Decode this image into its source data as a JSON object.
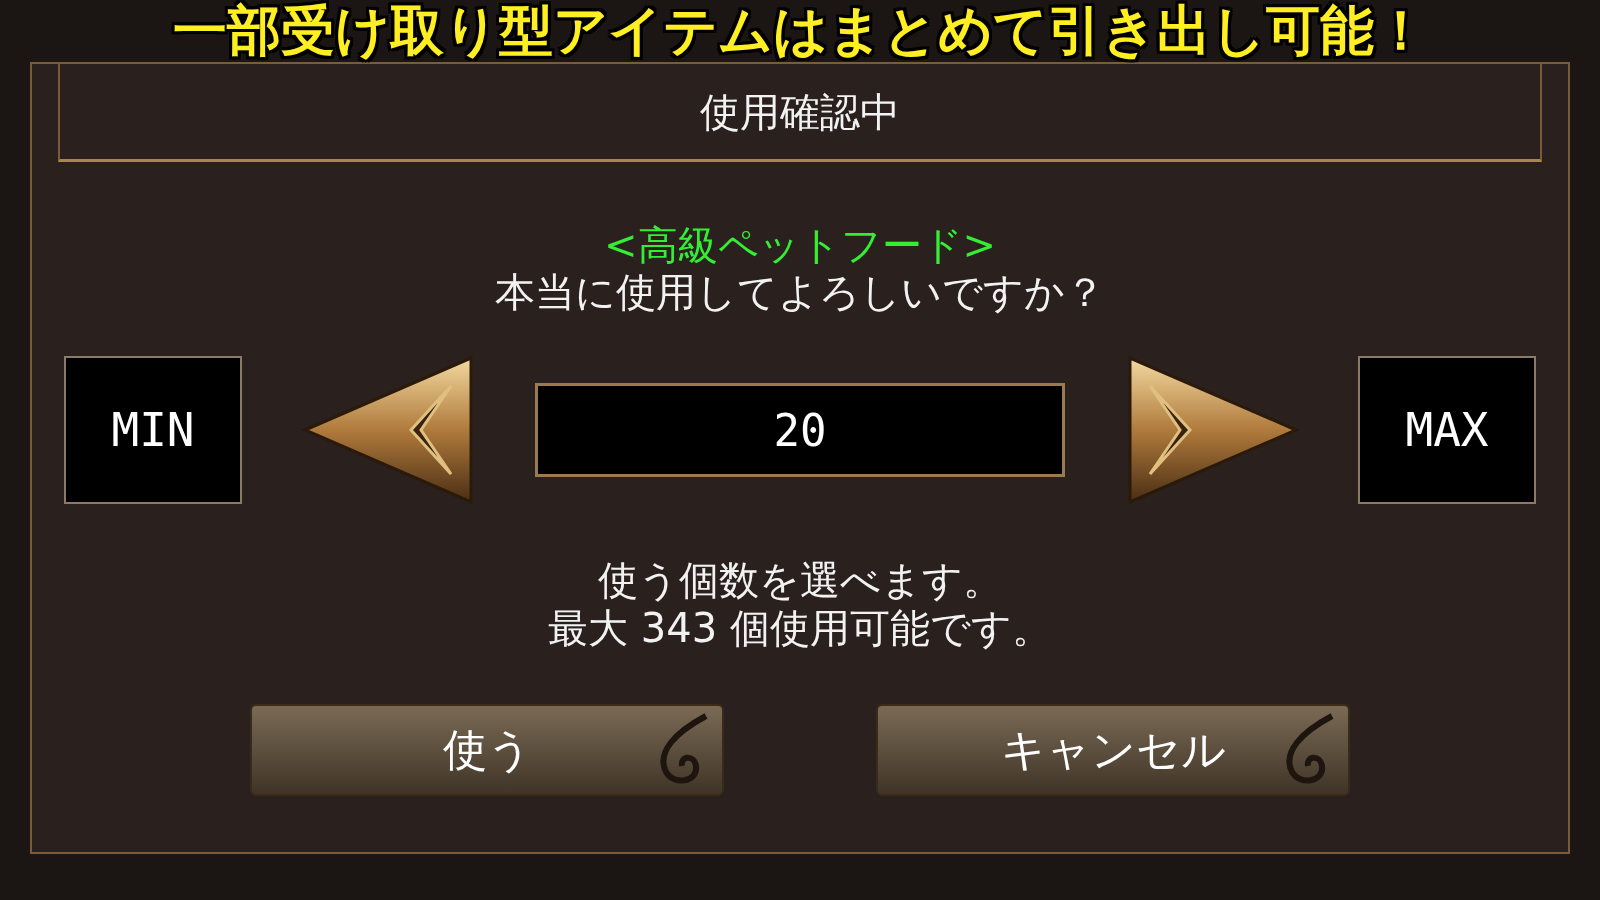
{
  "caption": "一部受け取り型アイテムはまとめて引き出し可能！",
  "dialog": {
    "title": "使用確認中",
    "item_name": "<高級ペットフード>",
    "question": "本当に使用してよろしいですか？",
    "min_button": "MIN",
    "max_button": "MAX",
    "quantity": "20",
    "info_lines": [
      "使う個数を選べます。",
      "最大 343 個使用可能です。"
    ],
    "buttons": [
      {
        "label": "使う"
      },
      {
        "label": "キャンセル"
      }
    ]
  }
}
